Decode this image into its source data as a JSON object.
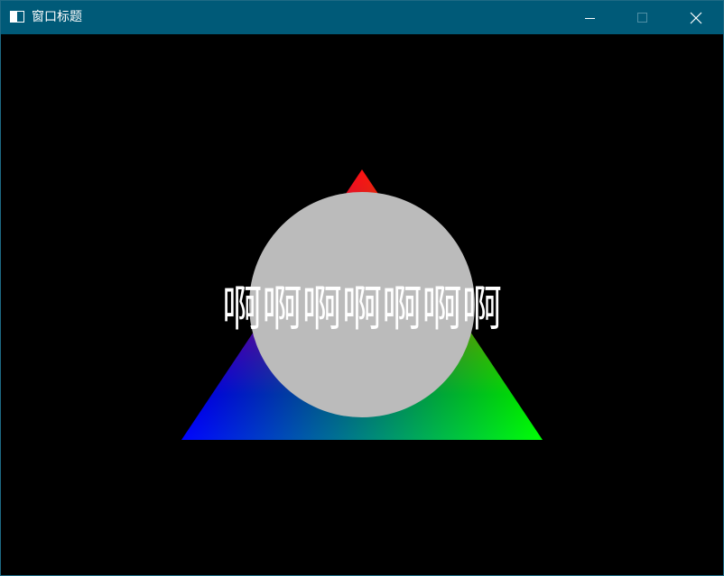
{
  "window": {
    "title": "窗口标题",
    "icon": "app-window-icon",
    "controls": {
      "minimize_icon": "minimize-icon",
      "maximize_icon": "maximize-icon",
      "close_icon": "close-icon"
    }
  },
  "scene": {
    "overlay_text": "啊啊啊啊啊啊啊",
    "triangle": {
      "vertex_colors": [
        "#ff0000",
        "#0000ff",
        "#00ff00"
      ]
    },
    "circle": {
      "color": "#bbbbbb"
    },
    "background": "#000000"
  },
  "colors": {
    "titlebar": "#005a78",
    "title_text": "#ffffff"
  }
}
